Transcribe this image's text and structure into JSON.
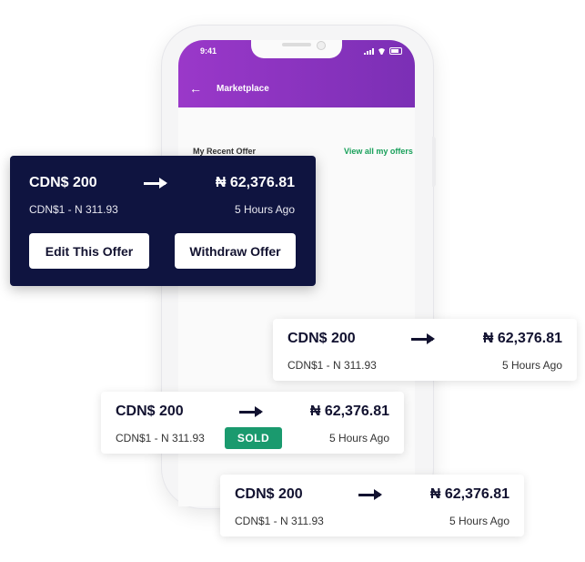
{
  "phone": {
    "status_time": "9:41",
    "header_title": "Marketplace",
    "recent_offer_label": "My Recent Offer",
    "view_all_link": "View all my offers"
  },
  "offer_card_primary": {
    "amount": "CDN$ 200",
    "converted": "₦ 62,376.81",
    "rate": "CDN$1 - N 311.93",
    "time": "5 Hours Ago",
    "edit_button": "Edit This Offer",
    "withdraw_button": "Withdraw Offer"
  },
  "offer_cards": [
    {
      "amount": "CDN$ 200",
      "converted": "₦ 62,376.81",
      "rate": "CDN$1 - N 311.93",
      "time": "5 Hours Ago"
    },
    {
      "amount": "CDN$ 200",
      "converted": "₦ 62,376.81",
      "rate": "CDN$1 - N 311.93",
      "time": "5 Hours Ago",
      "badge": "SOLD"
    },
    {
      "amount": "CDN$ 200",
      "converted": "₦ 62,376.81",
      "rate": "CDN$1 - N 311.93",
      "time": "5 Hours Ago"
    }
  ],
  "colors": {
    "header_purple": "#8a34c0",
    "dark_card": "#0f1440",
    "link_green": "#18a05a",
    "sold_green": "#1a9a6e"
  }
}
